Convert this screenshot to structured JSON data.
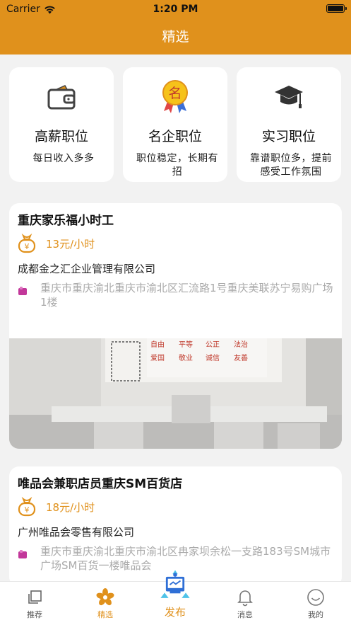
{
  "status_bar": {
    "carrier": "Carrier",
    "time": "1:20 PM"
  },
  "header": {
    "title": "精选"
  },
  "categories": [
    {
      "icon": "wallet-icon",
      "title": "高薪职位",
      "subtitle": "每日收入多多"
    },
    {
      "icon": "medal-icon",
      "badge_char": "名",
      "title": "名企职位",
      "subtitle": "职位稳定，长期有招"
    },
    {
      "icon": "graduation-cap-icon",
      "title": "实习职位",
      "subtitle": "靠谱职位多，提前感受工作氛围"
    }
  ],
  "jobs": [
    {
      "title": "重庆家乐福小时工",
      "salary": "13元/小时",
      "company": "成都金之汇企业管理有限公司",
      "address": "重庆市重庆渝北重庆市渝北区汇流路1号重庆美联苏宁易购广场1楼",
      "photo_banner_text": [
        "自由",
        "平等",
        "公正",
        "法治",
        "爱国",
        "敬业",
        "诚信",
        "友善"
      ]
    },
    {
      "title": "唯品会兼职店员重庆SM百货店",
      "salary": "18元/小时",
      "company": "广州唯品会零售有限公司",
      "address": "重庆市重庆渝北重庆市渝北区冉家坝余松一支路183号SM城市广场SM百货一楼唯品会"
    }
  ],
  "tabbar": {
    "items": [
      {
        "label": "推荐",
        "icon": "copy-icon"
      },
      {
        "label": "精选",
        "icon": "flower-icon",
        "active": true
      },
      {
        "label": "发布",
        "icon": "publish-icon"
      },
      {
        "label": "消息",
        "icon": "bell-icon"
      },
      {
        "label": "我的",
        "icon": "smile-icon"
      }
    ]
  },
  "colors": {
    "accent": "#e0911c",
    "background": "#f2f2f2",
    "address_icon": "#c2379a"
  }
}
